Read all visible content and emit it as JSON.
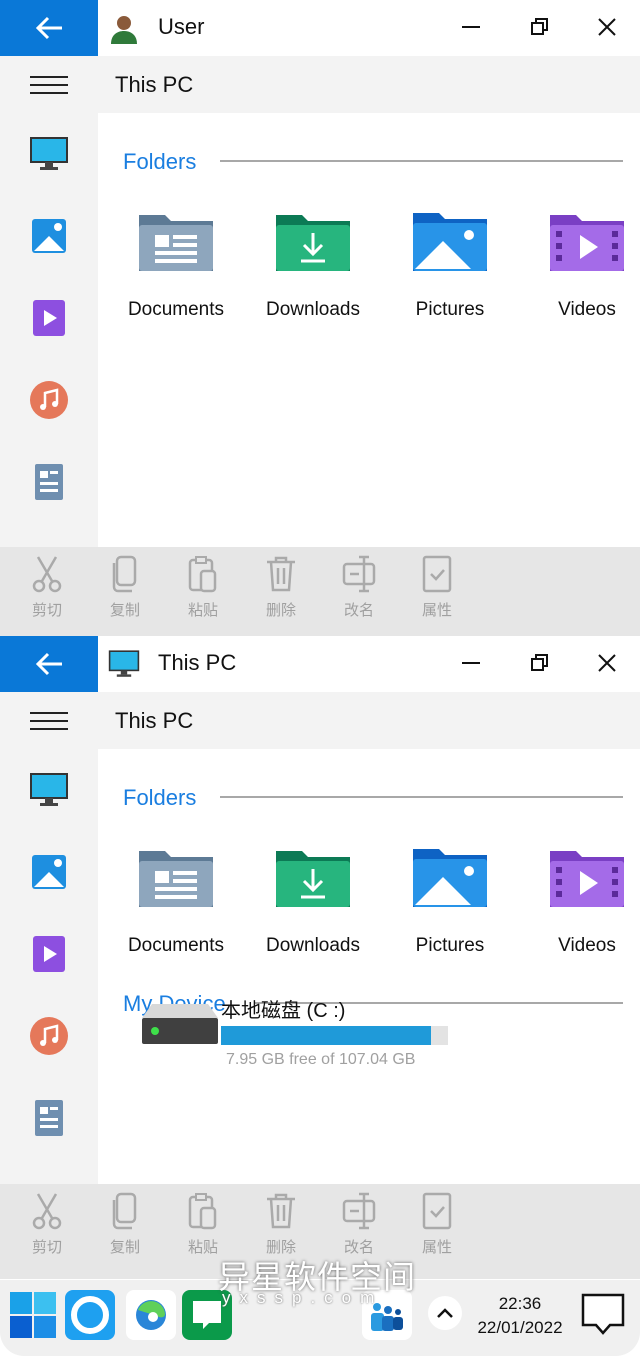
{
  "windows": [
    {
      "title": "User",
      "title_icon": "user-avatar-icon",
      "header": "This PC",
      "folders_label": "Folders",
      "folders": [
        {
          "label": "Documents",
          "icon": "documents-folder-icon"
        },
        {
          "label": "Downloads",
          "icon": "downloads-folder-icon"
        },
        {
          "label": "Pictures",
          "icon": "pictures-folder-icon"
        },
        {
          "label": "Videos",
          "icon": "videos-folder-icon"
        }
      ],
      "device": null
    },
    {
      "title": "This PC",
      "title_icon": "monitor-icon",
      "header": "This PC",
      "folders_label": "Folders",
      "folders": [
        {
          "label": "Documents",
          "icon": "documents-folder-icon"
        },
        {
          "label": "Downloads",
          "icon": "downloads-folder-icon"
        },
        {
          "label": "Pictures",
          "icon": "pictures-folder-icon"
        },
        {
          "label": "Videos",
          "icon": "videos-folder-icon"
        }
      ],
      "device": {
        "section_label": "My Device",
        "name": "本地磁盘 (C :)",
        "free_text": "7.95 GB free of 107.04 GB",
        "used_percent": 92.6
      }
    }
  ],
  "sidebar_icons": [
    "monitor-icon",
    "pictures-icon",
    "videos-icon",
    "music-icon",
    "documents-icon"
  ],
  "toolbar": [
    {
      "label": "剪切",
      "icon": "scissors-icon"
    },
    {
      "label": "复制",
      "icon": "copy-icon"
    },
    {
      "label": "粘贴",
      "icon": "paste-icon"
    },
    {
      "label": "删除",
      "icon": "trash-icon"
    },
    {
      "label": "改名",
      "icon": "rename-icon"
    },
    {
      "label": "属性",
      "icon": "properties-icon"
    }
  ],
  "taskbar": {
    "time": "22:36",
    "date": "22/01/2022",
    "apps": [
      "windows-start-icon",
      "cortana-icon",
      "edge-icon",
      "chat-icon",
      "people-icon"
    ]
  },
  "watermark": {
    "text": "异星软件空间",
    "url": "yxssp.com"
  },
  "colors": {
    "accent": "#0a78d7",
    "section": "#1a7ee0",
    "storage_bar": "#1f9ad9"
  }
}
